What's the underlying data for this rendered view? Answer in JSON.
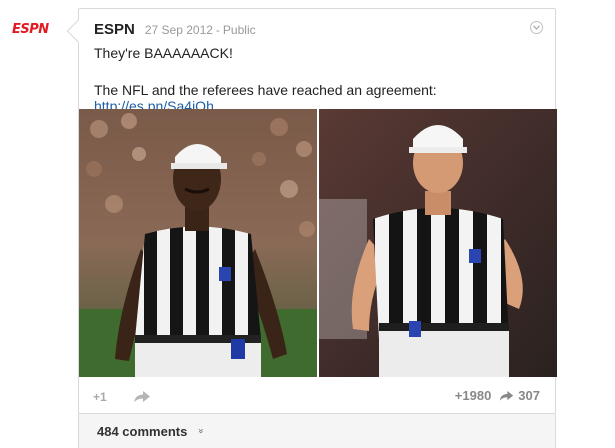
{
  "avatar": {
    "logo_text": "ESPN"
  },
  "post": {
    "author": "ESPN",
    "date": "27 Sep 2012",
    "visibility": "Public",
    "separator": "-",
    "line1": "They're BAAAAAACK!",
    "line2_prefix": "The NFL and the referees have reached an agreement: ",
    "link_text": "http://es.pn/Sa4iOh"
  },
  "actions": {
    "plus_one": "+1",
    "plus_count": "+1980",
    "share_count": "307"
  },
  "comments": {
    "label": "484 comments",
    "chevron": "»"
  },
  "colors": {
    "brand": "#e01b22",
    "link": "#1d5ea8"
  }
}
